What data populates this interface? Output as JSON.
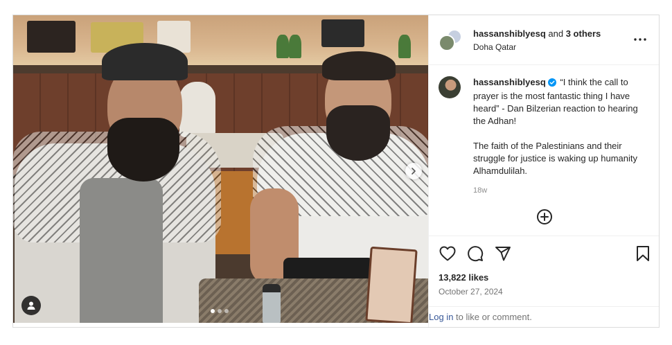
{
  "post": {
    "header": {
      "username": "hassanshiblyesq",
      "joiner": " and ",
      "others": "3 others",
      "location": "Doha Qatar"
    },
    "caption": {
      "username": "hassanshiblyesq",
      "paragraph1": "“I think the call to prayer is the most fantastic thing I have heard” - Dan Bilzerian reaction to hearing the Adhan!",
      "paragraph2": "The faith of the Palestinians and their struggle for justice is waking up humanity Alhamdulilah.",
      "time_ago": "18w"
    },
    "likes": "13,822 likes",
    "date": "October 27, 2024",
    "login": {
      "link_text": "Log in",
      "rest_text": " to like or comment."
    },
    "carousel": {
      "slide_count": 3,
      "active_index": 0
    },
    "icons": {
      "more": "more-options-icon",
      "verified": "verified-badge-icon",
      "like": "heart-icon",
      "comment": "comment-icon",
      "share": "share-icon",
      "save": "bookmark-icon",
      "add": "add-comment-icon",
      "next": "chevron-right-icon",
      "tags": "user-tag-icon"
    },
    "colors": {
      "verified": "#0095f6",
      "link": "#385898",
      "muted": "#8e8e8e"
    }
  }
}
